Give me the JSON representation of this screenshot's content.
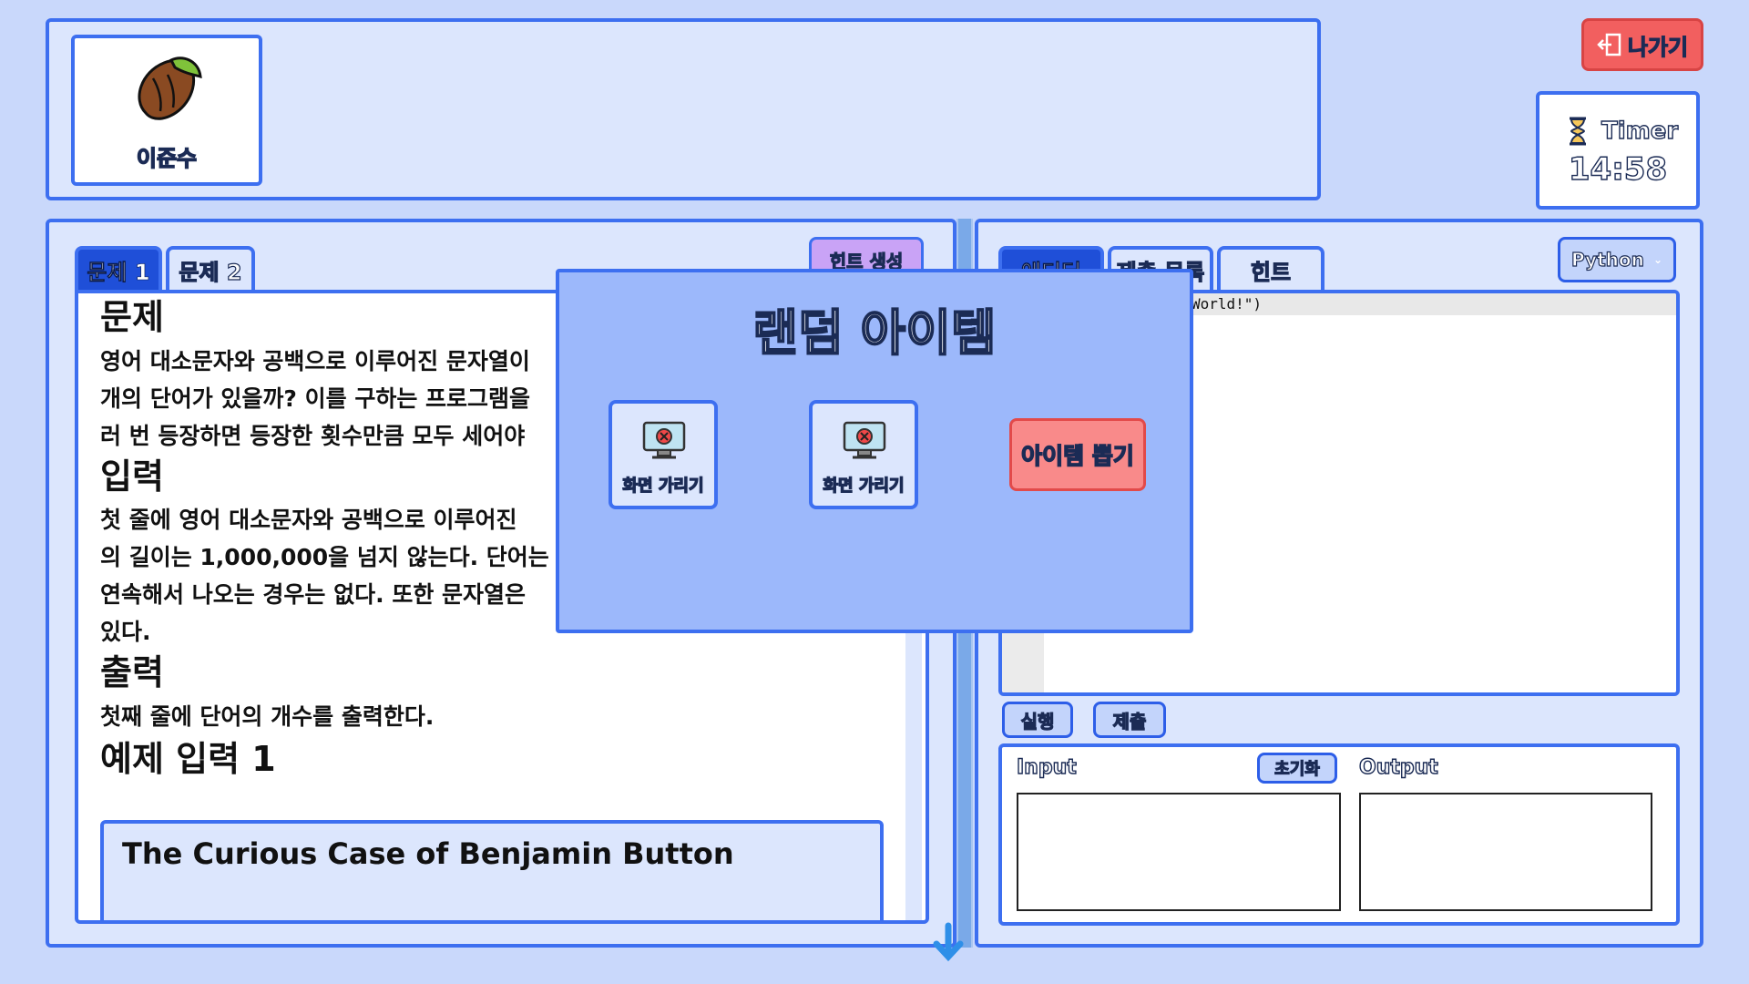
{
  "player": {
    "name": "이준수",
    "avatar_icon": "seed-icon"
  },
  "exit_button": {
    "label": "나가기",
    "icon": "exit-door-icon"
  },
  "timer": {
    "label": "Timer",
    "value": "14:58",
    "icon": "hourglass-icon"
  },
  "problem_tabs": [
    {
      "label": "문제 1",
      "active": true
    },
    {
      "label": "문제 2",
      "active": false
    }
  ],
  "hint_generate_label": "힌트 생성",
  "problem": {
    "title": "문제",
    "body_lines": [
      "영어 대소문자와 공백으로 이루어진 문자열이",
      "개의 단어가 있을까? 이를 구하는 프로그램을",
      "러 번 등장하면 등장한 횟수만큼 모두 세어야"
    ],
    "input_title": "입력",
    "input_lines": [
      "첫 줄에 영어 대소문자와 공백으로 이루어진",
      "의 길이는 1,000,000을 넘지 않는다. 단어는",
      "연속해서 나오는 경우는 없다. 또한 문자열은",
      "있다."
    ],
    "output_title": "출력",
    "output_lines": [
      "첫째 줄에 단어의 개수를 출력한다."
    ],
    "example_title": "예제 입력 1",
    "example_input": "The Curious Case of Benjamin Button"
  },
  "editor_tabs": [
    {
      "label": "에디터",
      "active": true
    },
    {
      "label": "제출 목록",
      "active": false
    },
    {
      "label": "힌트",
      "active": false
    }
  ],
  "language_select": {
    "value": "Python"
  },
  "code_fragment": "World!\")",
  "run_label": "실행",
  "submit_label": "제출",
  "io": {
    "input_label": "Input",
    "reset_label": "초기화",
    "output_label": "Output",
    "input_value": "",
    "output_value": ""
  },
  "modal": {
    "title": "랜덤 아이템",
    "items": [
      {
        "label": "화면 가리기",
        "icon": "monitor-error-icon"
      },
      {
        "label": "화면 가리기",
        "icon": "monitor-error-icon"
      }
    ],
    "draw_button_label": "아이템 뽑기"
  },
  "colors": {
    "accent": "#3d6ff0",
    "panel": "#dce6fd",
    "background": "#c9d8fb",
    "modal": "#9cb8fb",
    "exit": "#f25f5f",
    "hint": "#c9a3f6"
  }
}
